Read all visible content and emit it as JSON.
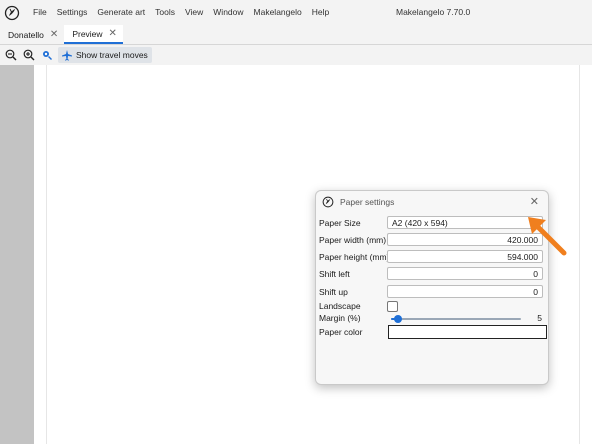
{
  "window": {
    "title": "Makelangelo 7.70.0"
  },
  "menu": {
    "items": [
      "File",
      "Settings",
      "Generate art",
      "Tools",
      "View",
      "Window",
      "Makelangelo",
      "Help"
    ]
  },
  "tabs": [
    {
      "label": "Donatello",
      "active": false
    },
    {
      "label": "Preview",
      "active": true
    }
  ],
  "toolbar": {
    "zoom_out_icon": "zoom-out-icon",
    "zoom_in_icon": "zoom-in-icon",
    "pick_icon": "camera-icon",
    "travel_label": "Show travel moves"
  },
  "dialog": {
    "title": "Paper settings",
    "paper_size": {
      "label": "Paper Size",
      "value": "A2 (420 x 594)"
    },
    "paper_width": {
      "label": "Paper width (mm)",
      "value": "420.000"
    },
    "paper_height": {
      "label": "Paper height (mm)",
      "value": "594.000"
    },
    "shift_left": {
      "label": "Shift left",
      "value": "0"
    },
    "shift_up": {
      "label": "Shift up",
      "value": "0"
    },
    "landscape": {
      "label": "Landscape",
      "checked": false
    },
    "margin": {
      "label": "Margin (%)",
      "value": "5",
      "fraction": 0.05
    },
    "paper_color": {
      "label": "Paper color",
      "color": "#ffffff"
    }
  },
  "colors": {
    "accent": "#1f6fd6",
    "annotation": "#f07f1e"
  }
}
